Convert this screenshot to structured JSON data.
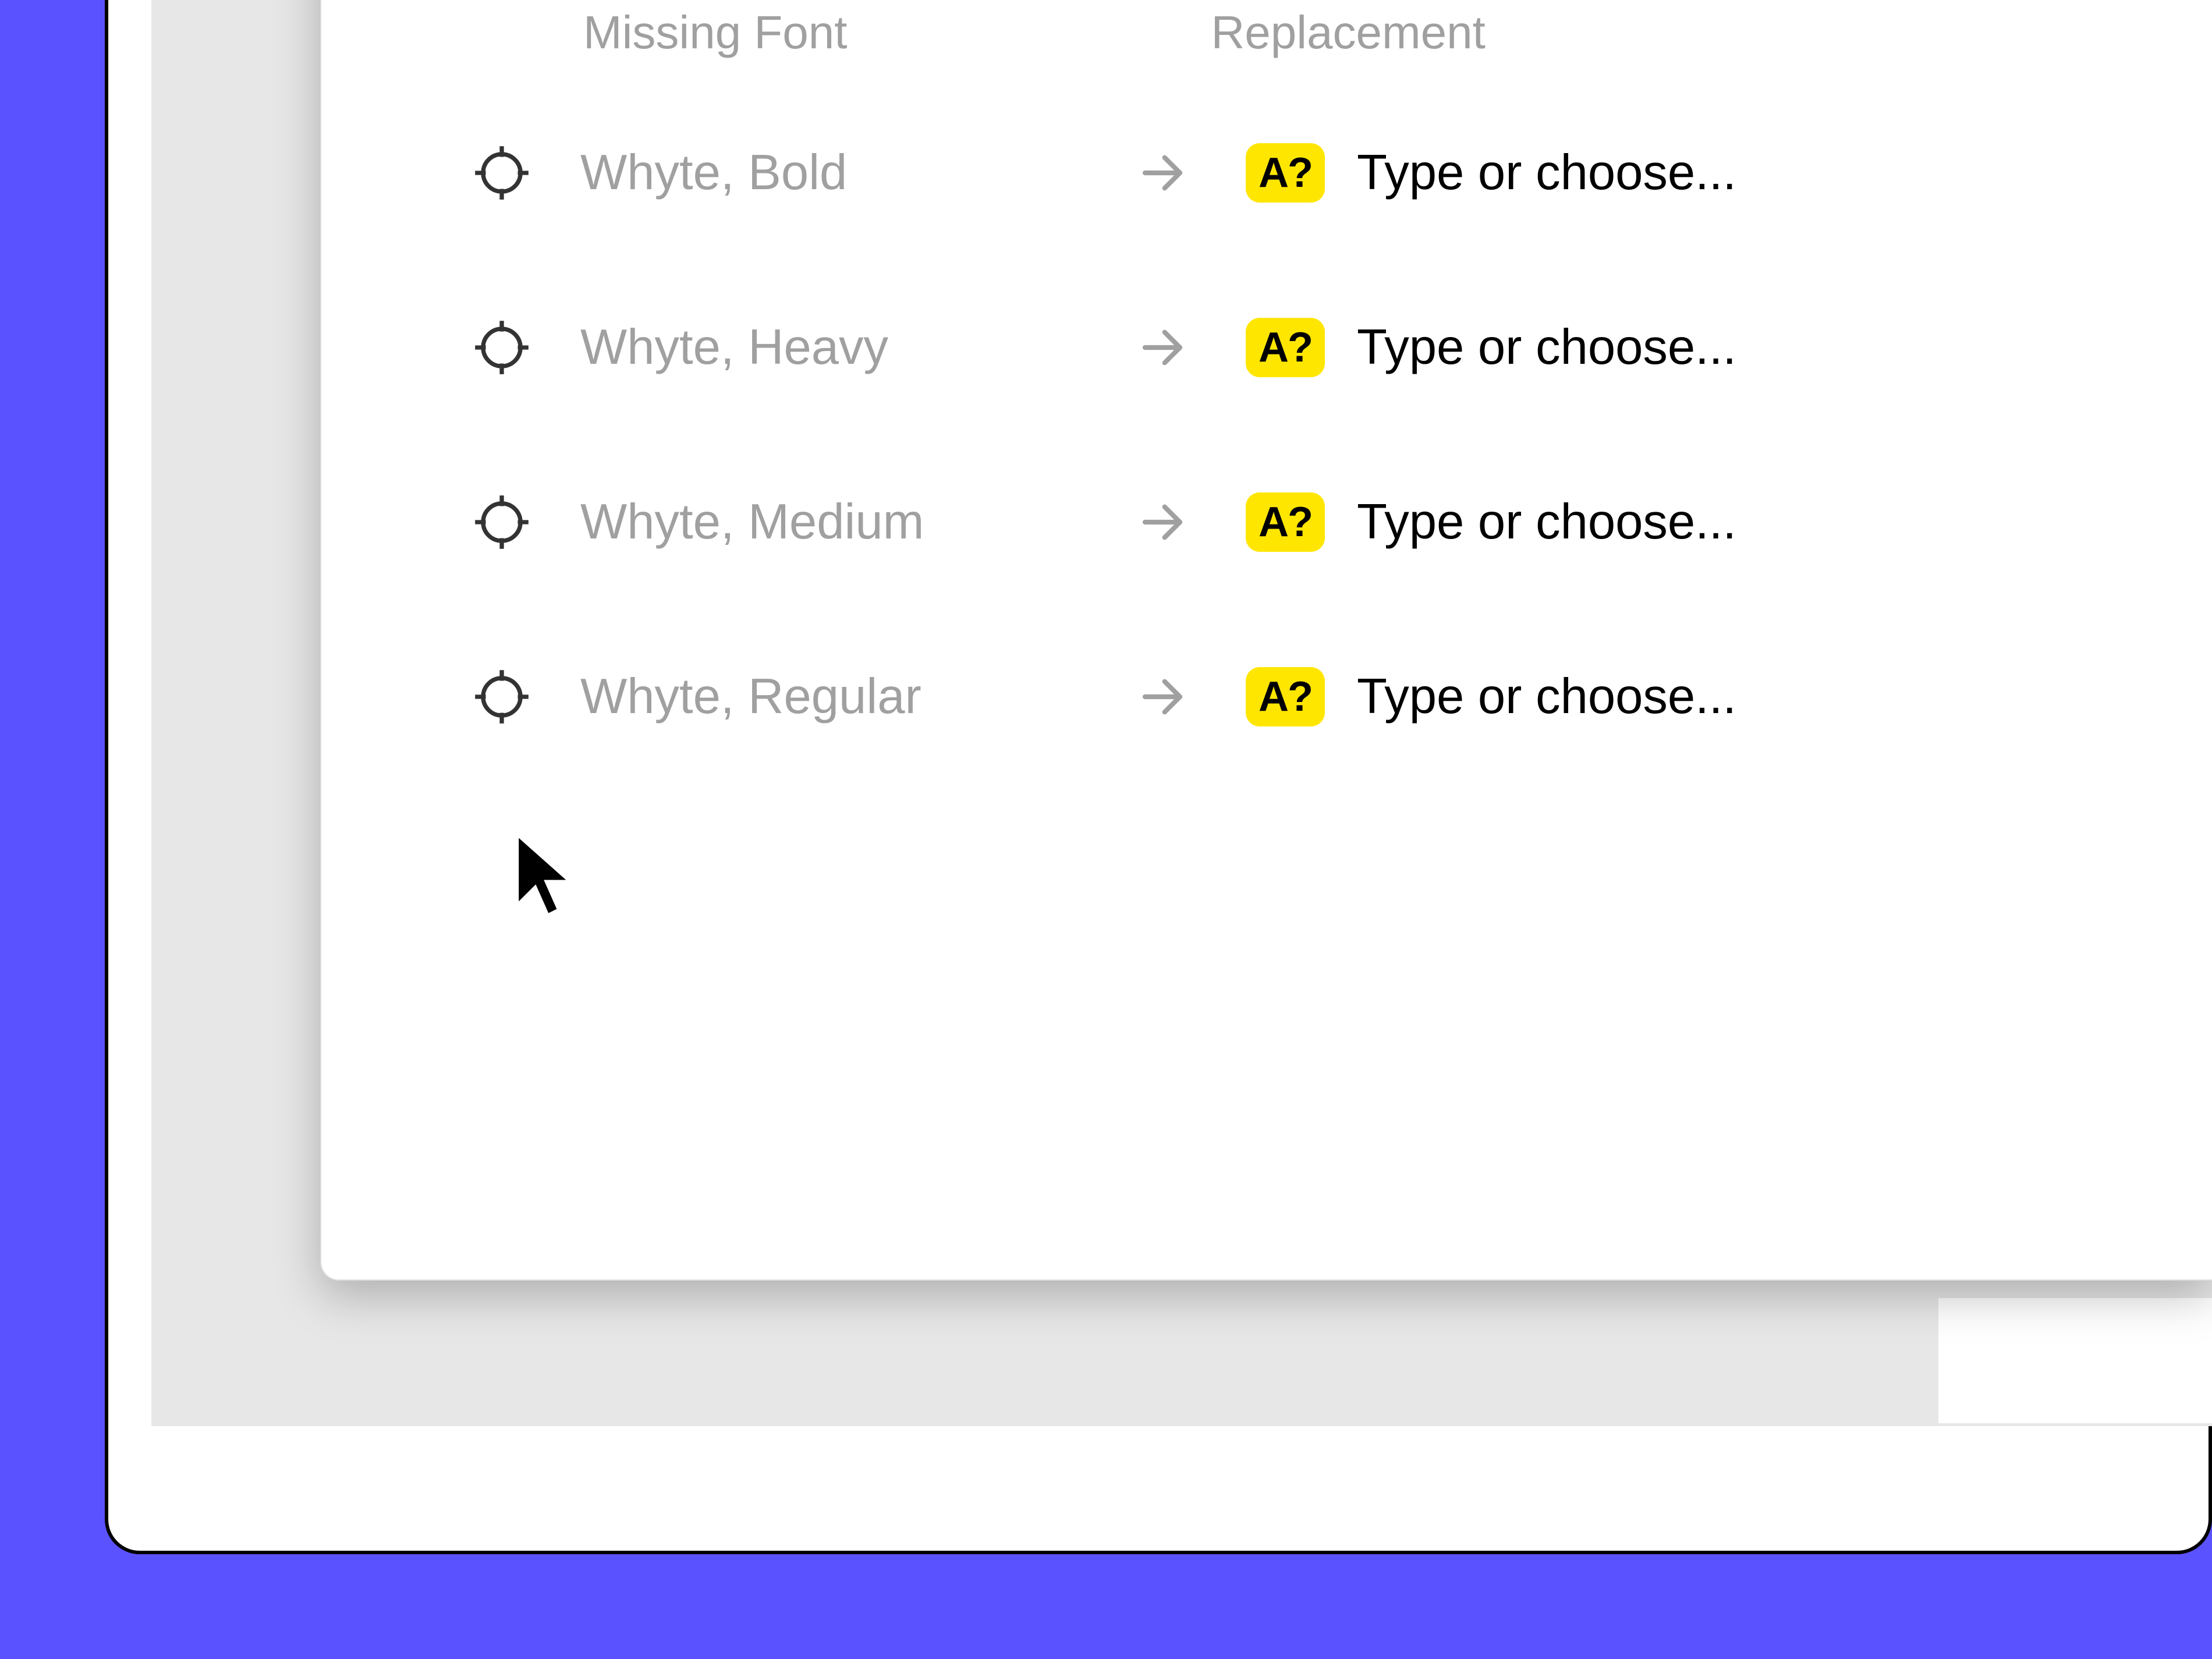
{
  "headers": {
    "missing": "Missing Font",
    "replacement": "Replacement"
  },
  "badge_text": "A?",
  "placeholder": "Type or choose...",
  "rows": [
    {
      "font": "Whyte, Bold"
    },
    {
      "font": "Whyte, Heavy"
    },
    {
      "font": "Whyte, Medium"
    },
    {
      "font": "Whyte, Regular"
    }
  ]
}
